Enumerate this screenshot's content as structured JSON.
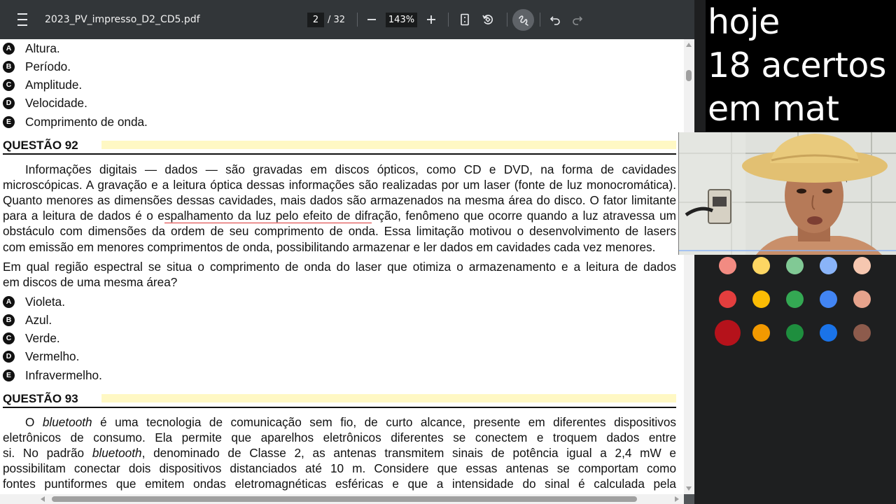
{
  "toolbar": {
    "title": "2023_PV_impresso_D2_CD5.pdf",
    "page_current": "2",
    "page_total": "/ 32",
    "zoom": "143%"
  },
  "question91_options": [
    {
      "letter": "A",
      "text": "Altura."
    },
    {
      "letter": "B",
      "text": "Período."
    },
    {
      "letter": "C",
      "text": "Amplitude."
    },
    {
      "letter": "D",
      "text": "Velocidade."
    },
    {
      "letter": "E",
      "text": "Comprimento de onda."
    }
  ],
  "question92": {
    "title": "QUESTÃO 92",
    "paragraph": [
      "Informações digitais — dados — são gravadas em discos ópticos, como CD e DVD, na forma de cavidades",
      "microscópicas. A gravação e a leitura óptica dessas informações são realizadas por um laser (fonte de luz monocromática).",
      "Quanto menores as dimensões dessas cavidades, mais dados são armazenados na mesma área do disco. O fator limitante",
      "obstáculo com dimensões da ordem de seu comprimento de onda. Essa limitação motivou o desenvolvimento de lasers",
      "com emissão em menores comprimentos de onda, possibilitando armazenar e ler dados em cavidades cada vez menores."
    ],
    "line4_before": "para a leitura de dados é o e",
    "line4_underlined": "spalhamento da luz pelo efeito de difr",
    "line4_after": "ação, fenômeno que ocorre quando a luz atravessa um",
    "prompt": [
      "Em qual região espectral se situa o comprimento de onda do laser que otimiza o armazenamento e a leitura de dados",
      "em discos de uma mesma área?"
    ],
    "options": [
      {
        "letter": "A",
        "text": "Violeta."
      },
      {
        "letter": "B",
        "text": "Azul."
      },
      {
        "letter": "C",
        "text": "Verde."
      },
      {
        "letter": "D",
        "text": "Vermelho."
      },
      {
        "letter": "E",
        "text": "Infravermelho."
      }
    ]
  },
  "question93": {
    "title": "QUESTÃO 93",
    "line1_before": "O ",
    "line1_italic": "bluetooth",
    "line1_after": " é uma tecnologia de comunicação sem fio, de curto alcance, presente em diferentes dispositivos",
    "line2": "eletrônicos de consumo. Ela permite que aparelhos eletrônicos diferentes se conectem e troquem dados entre",
    "line3_before": "si. No padrão ",
    "line3_italic": "bluetooth",
    "line3_after": ", denominado de Classe 2, as antenas transmitem sinais de potência igual a 2,4 mW e",
    "line4": "possibilitam conectar dois dispositivos distanciados até 10 m. Considere que essas antenas se comportam como",
    "line5": "fontes puntiformes que emitem ondas eletromagnéticas esféricas e que a intensidade do sinal é calculada pela"
  },
  "note": [
    "hoje",
    "18 acertos",
    "em mat"
  ],
  "palette": {
    "row1": [
      "#f28b82",
      "#fdd663",
      "#81c995",
      "#8ab4f8",
      "#f6c7b0"
    ],
    "row2": [
      "#e33e3e",
      "#fbbc04",
      "#34a853",
      "#4285f4",
      "#e6a38c"
    ],
    "row3": [
      "#b5121b",
      "#f29900",
      "#1e8e3e",
      "#1a73e8",
      "#8d5b4c"
    ]
  }
}
